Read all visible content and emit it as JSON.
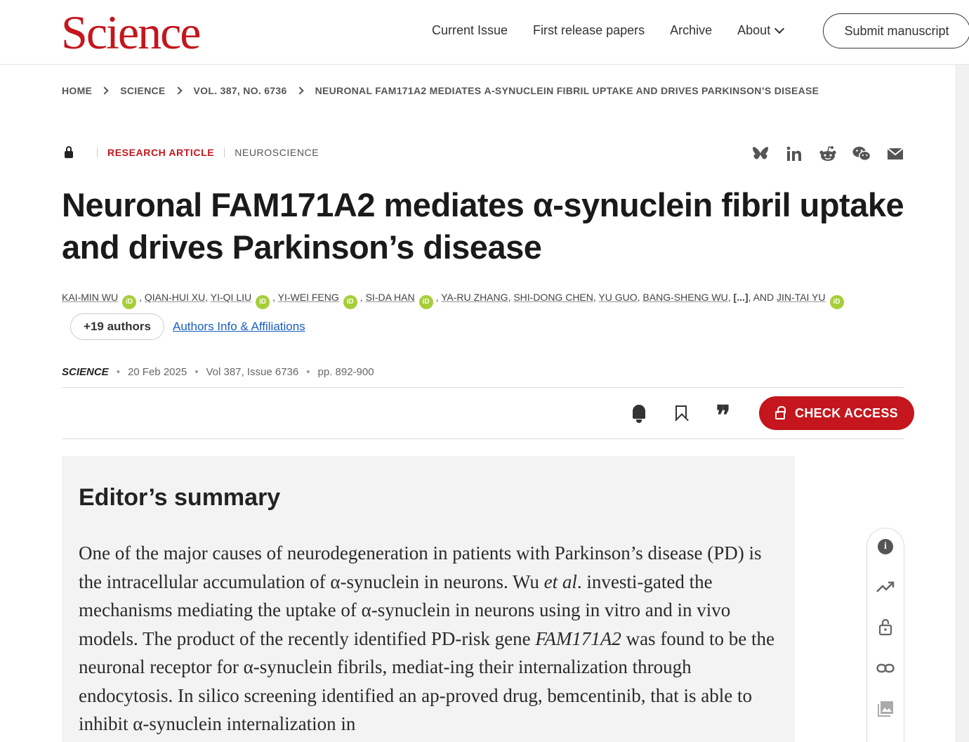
{
  "header": {
    "logo": "Science",
    "nav": [
      "Current Issue",
      "First release papers",
      "Archive",
      "About"
    ],
    "submit_label": "Submit manuscript"
  },
  "breadcrumb": [
    "HOME",
    "SCIENCE",
    "VOL. 387, NO. 6736",
    "NEURONAL FAM171A2 MEDIATES Α-SYNUCLEIN FIBRIL UPTAKE AND DRIVES PARKINSON’S DISEASE"
  ],
  "article": {
    "type": "RESEARCH ARTICLE",
    "section": "NEUROSCIENCE",
    "title": "Neuronal FAM171A2 mediates α-synuclein fibril uptake and drives Parkinson’s disease",
    "authors": {
      "a1": "KAI-MIN WU",
      "a2": "QIAN-HUI XU",
      "a3": "YI-QI LIU",
      "a4": "YI-WEI FENG",
      "a5": "SI-DA HAN",
      "a6": "YA-RU ZHANG",
      "a7": "SHI-DONG CHEN",
      "a8": "YU GUO",
      "a9": "BANG-SHENG WU",
      "ellipsis": "[...]",
      "and": "AND",
      "a10": "JIN-TAI YU"
    },
    "orcid_label": "iD",
    "more_authors": "+19 authors",
    "affiliations_link": "Authors Info & Affiliations",
    "journal": "SCIENCE",
    "date": "20 Feb 2025",
    "volume": "Vol 387, Issue 6736",
    "pages": "pp. 892-900"
  },
  "actions": {
    "check_access": "CHECK ACCESS",
    "quote_glyph": "❞"
  },
  "share_icons": [
    "bluesky-icon",
    "linkedin-icon",
    "reddit-icon",
    "wechat-icon",
    "email-icon"
  ],
  "summary": {
    "heading": "Editor’s summary",
    "p1": "One of the major causes of neurodegeneration in patients with Parkinson’s disease (PD) is the intracellular accumulation of ",
    "alpha": "α",
    "p2": "-synuclein in neurons. Wu ",
    "etal": "et al",
    "p3": ". investi-gated the mechanisms mediating the uptake of ",
    "p4": "-synuclein in neurons using in vitro and in vivo models. The product of the recently identified PD-risk gene ",
    "gene": "FAM171A2",
    "p5": " was found to be the neuronal receptor for ",
    "p6": "-synuclein fibrils, mediat-ing their internalization through endocytosis. In silico screening identified an ap-proved drug, bemcentinib, that is able to inhibit ",
    "p7": "-synuclein internalization in"
  },
  "colors": {
    "brand": "#c4161c",
    "link": "#1a5ec2",
    "orcid": "#a6ce39"
  }
}
